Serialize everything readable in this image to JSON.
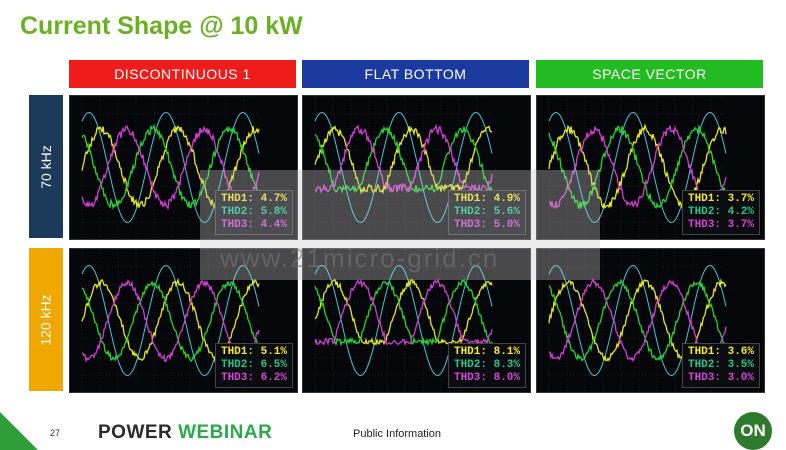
{
  "title": "Current Shape @ 10 kW",
  "columns": [
    {
      "label": "DISCONTINUOUS 1",
      "color": "#ef1c1c"
    },
    {
      "label": "FLAT BOTTOM",
      "color": "#1a3aa0"
    },
    {
      "label": "SPACE VECTOR",
      "color": "#22bb22"
    }
  ],
  "rows": [
    {
      "label": "70 kHz",
      "color": "#1c3a5a"
    },
    {
      "label": "120 kHz",
      "color": "#f0a800"
    }
  ],
  "panels": [
    [
      {
        "thd1": "THD1: 4.7%",
        "thd2": "THD2: 5.8%",
        "thd3": "THD3: 4.4%"
      },
      {
        "thd1": "THD1: 4.9%",
        "thd2": "THD2: 5.6%",
        "thd3": "THD3: 5.0%"
      },
      {
        "thd1": "THD1: 3.7%",
        "thd2": "THD2: 4.2%",
        "thd3": "THD3: 3.7%"
      }
    ],
    [
      {
        "thd1": "THD1: 5.1%",
        "thd2": "THD2: 6.5%",
        "thd3": "THD3: 6.2%"
      },
      {
        "thd1": "THD1: 8.1%",
        "thd2": "THD2: 8.3%",
        "thd3": "THD3: 8.0%"
      },
      {
        "thd1": "THD1: 3.6%",
        "thd2": "THD2: 3.5%",
        "thd3": "THD3: 3.0%"
      }
    ]
  ],
  "colors": {
    "thd1": "#f5ea2a",
    "thd2": "#1fc88a",
    "thd3": "#d544d5",
    "phase1": "#e8e81a",
    "phase2": "#22d62e",
    "phase3": "#d23dd2",
    "ref": "#40c8d8"
  },
  "footer": {
    "page": "27",
    "logo_a": "POWER",
    "logo_b": "WEBINAR",
    "info": "Public Information",
    "brand": "ON"
  },
  "watermark": "www.21micro-grid.cn"
}
